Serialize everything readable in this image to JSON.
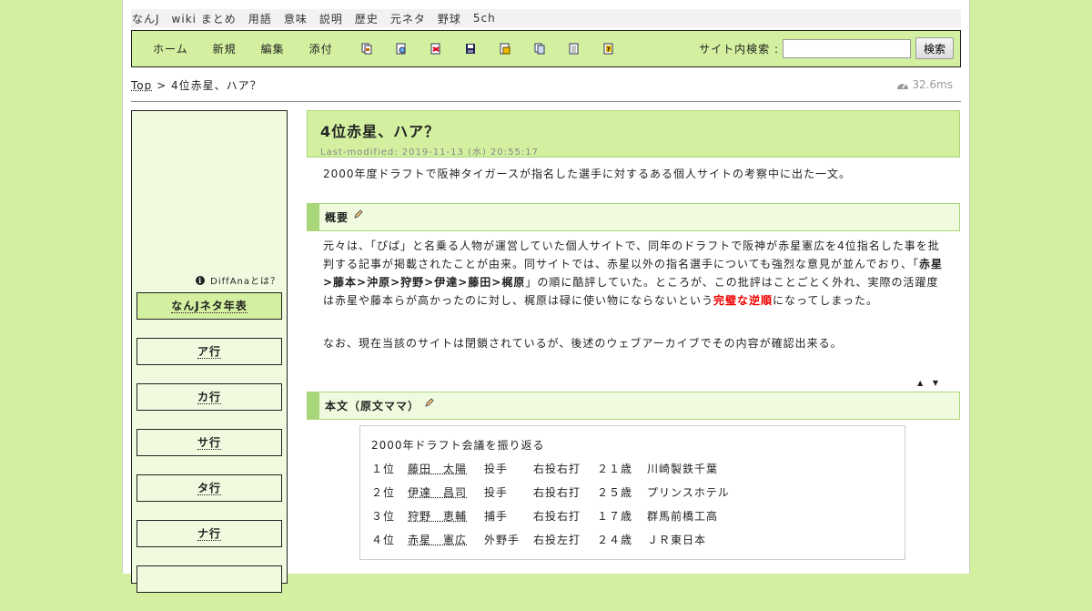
{
  "topnav": [
    "なんJ",
    "wiki まとめ",
    "用語",
    "意味",
    "説明",
    "歴史",
    "元ネタ",
    "野球",
    "5ch"
  ],
  "toolbar": {
    "links": [
      "ホーム",
      "新規",
      "編集",
      "添付"
    ],
    "icons": [
      "copy-icon",
      "diff-icon",
      "backup-icon",
      "save-icon",
      "freeze-icon",
      "rename-icon",
      "list-icon",
      "help-icon"
    ],
    "search_label": "サイト内検索 :",
    "search_placeholder": "",
    "search_button": "検索"
  },
  "breadcrumb": {
    "top": "Top",
    "sep": " > ",
    "current": "4位赤星、ハア？"
  },
  "timing": "32.6ms",
  "sidebar": {
    "diffana": "DiffAnaとは？",
    "items": [
      "なんJネタ年表",
      "ア行",
      "カ行",
      "サ行",
      "タ行",
      "ナ行"
    ]
  },
  "article": {
    "title": "4位赤星、ハア？",
    "last_modified": "Last-modified: 2019-11-13 (水) 20:55:17",
    "intro": "2000年度ドラフトで阪神タイガースが指名した選手に対するある個人サイトの考察中に出た一文。",
    "section1": {
      "heading": "概要",
      "p1_a": "元々は、「ぴぱ」と名乗る人物が運営していた個人サイトで、同年のドラフトで阪神が赤星憲広を4位指名した事を批判する記事が掲載されたことが由来。同サイトでは、赤星以外の指名選手についても強烈な意見が並んでおり、「",
      "p1_bold": "赤星>藤本>沖原>狩野>伊達>藤田>梶原",
      "p1_b": "」の順に酷評していた。ところが、この批評はことごとく外れ、実際の活躍度は赤星や藤本らが高かったのに対し、梶原は碌に使い物にならないという",
      "p1_red": "完璧な逆順",
      "p1_c": "になってしまった。",
      "p2": "なお、現在当該のサイトは閉鎖されているが、後述のウェブアーカイブでその内容が確認出来る。"
    },
    "arrows": "▲ ▼",
    "section2": {
      "heading": "本文（原文ママ）",
      "quote_title": "2000年ドラフト会議を振り返る",
      "rows": [
        [
          "１位",
          "藤田　太陽",
          "投手",
          "右投右打",
          "２１歳",
          "川崎製鉄千葉"
        ],
        [
          "２位",
          "伊達　昌司",
          "投手",
          "右投右打",
          "２５歳",
          "プリンスホテル"
        ],
        [
          "３位",
          "狩野　恵輔",
          "捕手",
          "右投右打",
          "１７歳",
          "群馬前橋工高"
        ],
        [
          "４位",
          "赤星　憲広",
          "外野手",
          "右投左打",
          "２４歳",
          "ＪＲ東日本"
        ]
      ]
    }
  }
}
